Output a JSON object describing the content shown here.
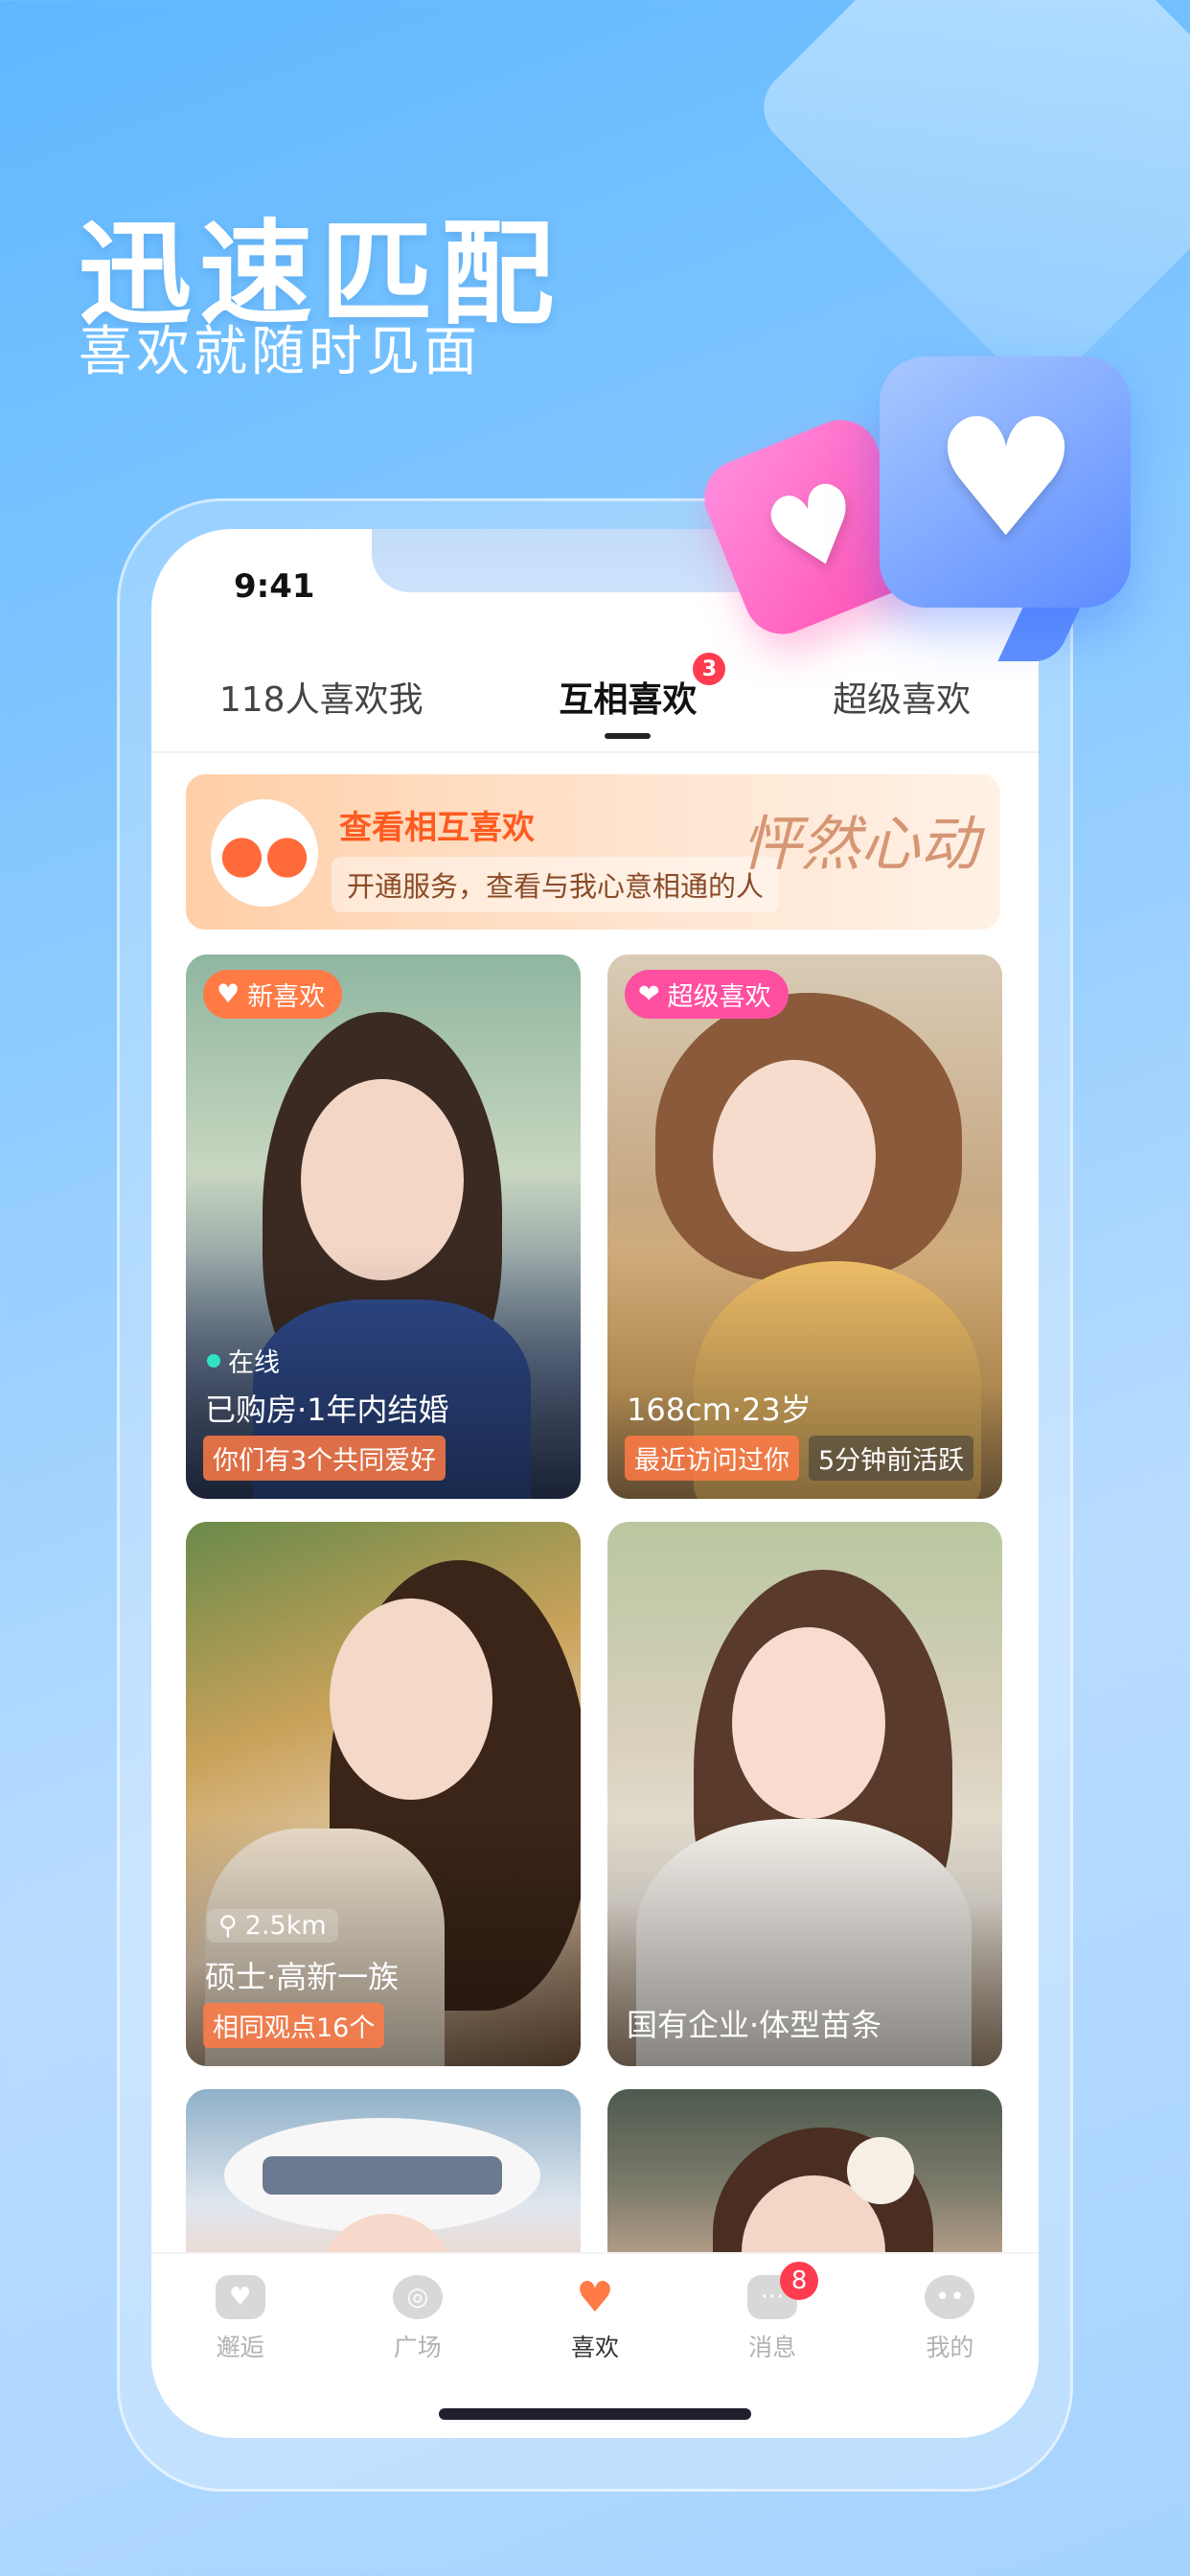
{
  "hero": {
    "title": "迅速匹配",
    "subtitle": "喜欢就随时见面"
  },
  "status_bar": {
    "time": "9:41"
  },
  "tabs": [
    {
      "label": "118人喜欢我",
      "active": false
    },
    {
      "label": "互相喜欢",
      "active": true,
      "badge": "3"
    },
    {
      "label": "超级喜欢",
      "active": false
    }
  ],
  "banner": {
    "title": "查看相互喜欢",
    "subtitle": "开通服务，查看与我心意相通的人",
    "script_text": "怦然心动"
  },
  "cards": [
    {
      "badge": "新喜欢",
      "badge_color": "#ff7a45",
      "status": "在线",
      "info": "已购房·1年内结婚",
      "tags": [
        "你们有3个共同爱好"
      ]
    },
    {
      "badge": "超级喜欢",
      "badge_color": "#ff4fa0",
      "info": "168cm·23岁",
      "tags": [
        "最近访问过你",
        "5分钟前活跃"
      ]
    },
    {
      "status": "2.5km",
      "info": "硕士·高新一族",
      "tags": [
        "相同观点16个"
      ]
    },
    {
      "info": "国有企业·体型苗条",
      "tags": []
    }
  ],
  "tabbar": [
    {
      "label": "邂逅",
      "icon": "card-heart-icon"
    },
    {
      "label": "广场",
      "icon": "planet-icon"
    },
    {
      "label": "喜欢",
      "icon": "heart-icon",
      "active": true
    },
    {
      "label": "消息",
      "icon": "chat-icon",
      "badge": "8"
    },
    {
      "label": "我的",
      "icon": "profile-icon"
    }
  ],
  "colors": {
    "accent_orange": "#ff5a1f",
    "badge_red": "#ff3b4f",
    "pink": "#ff4fa0"
  }
}
